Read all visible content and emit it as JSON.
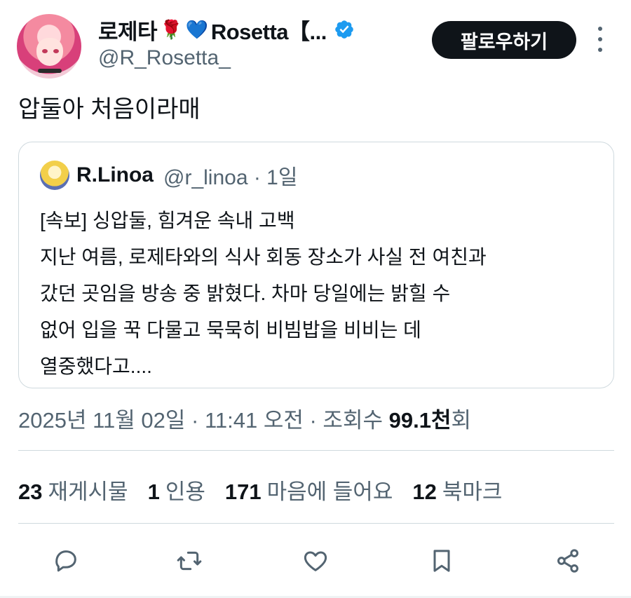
{
  "author": {
    "display_name": "로제타",
    "emoji_rose": "🌹",
    "emoji_heart": "💙",
    "display_name_suffix": "Rosetta【...",
    "handle": "@R_Rosetta_",
    "verified_color": "#1d9bf0"
  },
  "follow_button": {
    "label": "팔로우하기"
  },
  "tweet": {
    "text": "압둘아 처음이라매"
  },
  "quoted": {
    "name": "R.Linoa",
    "handle_time": "@r_linoa · 1일",
    "body": "[속보] 싱압둘, 힘겨운 속내 고백\n지난 여름, 로제타와의 식사 회동 장소가 사실 전 여친과\n갔던 곳임을 방송 중 밝혔다. 차마 당일에는 밝힐 수\n없어 입을 꾹 다물고 묵묵히 비빔밥을 비비는 데\n열중했다고...."
  },
  "meta": {
    "timestamp": "2025년 11월 02일 · 11:41 오전 · 조회수",
    "views_value": "99.1천",
    "views_suffix": "회"
  },
  "stats": [
    {
      "value": "23",
      "label": "재게시물"
    },
    {
      "value": "1",
      "label": "인용"
    },
    {
      "value": "171",
      "label": "마음에 들어요"
    },
    {
      "value": "12",
      "label": "북마크"
    }
  ],
  "actions": {
    "reply_icon": "reply-icon",
    "retweet_icon": "retweet-icon",
    "like_icon": "heart-icon",
    "bookmark_icon": "bookmark-icon",
    "share_icon": "share-icon"
  },
  "colors": {
    "text_primary": "#0f1419",
    "text_secondary": "#536471",
    "border": "#cfd9de"
  }
}
